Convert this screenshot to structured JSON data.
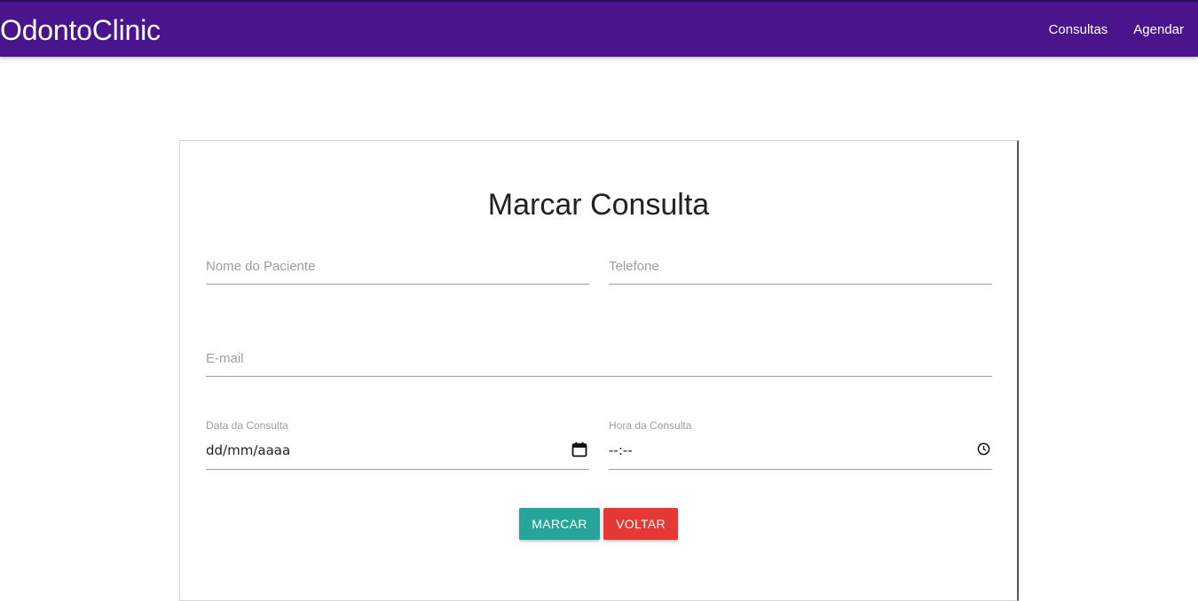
{
  "navbar": {
    "brand": "OdontoClinic",
    "links": [
      "Consultas",
      "Agendar"
    ],
    "color": "#4a148c"
  },
  "form": {
    "title": "Marcar Consulta",
    "nome_placeholder": "Nome do Paciente",
    "telefone_placeholder": "Telefone",
    "email_placeholder": "E-mail",
    "data_label": "Data da Consulta",
    "data_value": "dd/mm/aaaa",
    "data_icon": "calendar-icon",
    "hora_label": "Hora da Consulta",
    "hora_value": "--:--",
    "hora_icon": "clock-icon"
  },
  "buttons": {
    "marcar": "MARCAR",
    "marcar_color": "#26a69a",
    "voltar": "VOLTAR",
    "voltar_color": "#e53935"
  }
}
